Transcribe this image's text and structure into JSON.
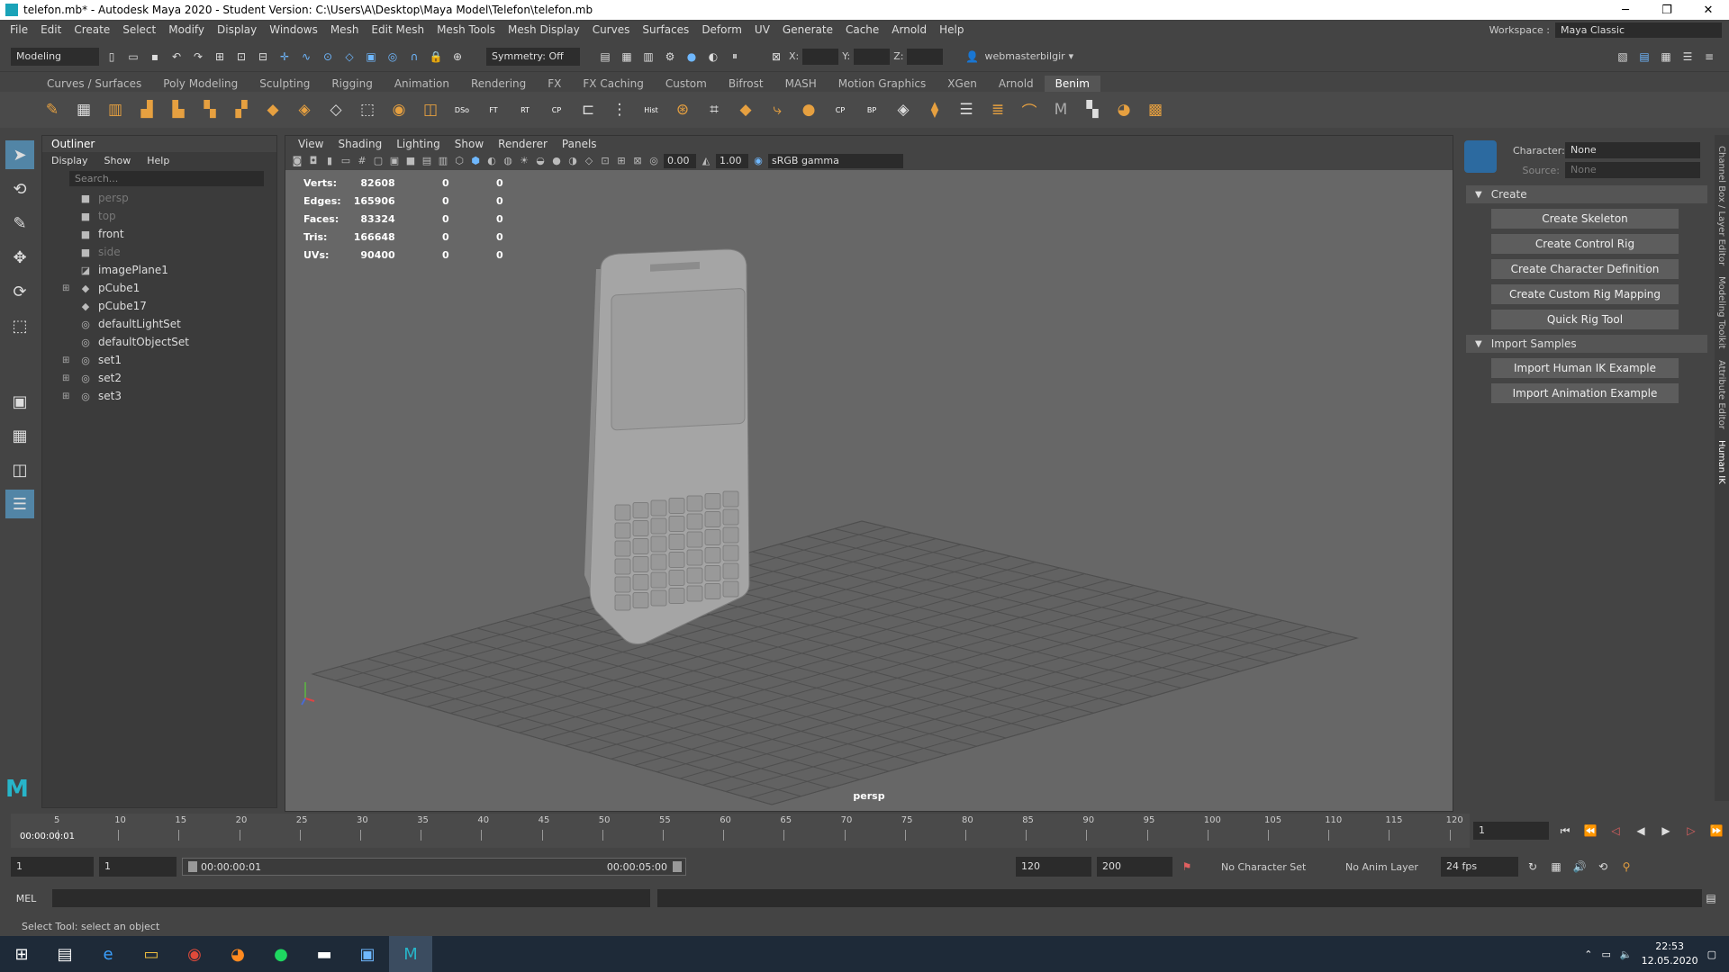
{
  "window": {
    "title": "telefon.mb* - Autodesk Maya 2020 - Student Version: C:\\Users\\A\\Desktop\\Maya Model\\Telefon\\telefon.mb"
  },
  "menubar": {
    "items": [
      "File",
      "Edit",
      "Create",
      "Select",
      "Modify",
      "Display",
      "Windows",
      "Mesh",
      "Edit Mesh",
      "Mesh Tools",
      "Mesh Display",
      "Curves",
      "Surfaces",
      "Deform",
      "UV",
      "Generate",
      "Cache",
      "Arnold",
      "Help"
    ],
    "workspace_label": "Workspace :",
    "workspace_value": "Maya Classic"
  },
  "statusline": {
    "mode": "Modeling",
    "symmetry": "Symmetry: Off",
    "x_label": "X:",
    "y_label": "Y:",
    "z_label": "Z:",
    "user": "webmasterbilgir"
  },
  "shelf": {
    "tabs": [
      "Curves / Surfaces",
      "Poly Modeling",
      "Sculpting",
      "Rigging",
      "Animation",
      "Rendering",
      "FX",
      "FX Caching",
      "Custom",
      "Bifrost",
      "MASH",
      "Motion Graphics",
      "XGen",
      "Arnold",
      "Benim"
    ],
    "active_tab": "Benim",
    "icon_labels": {
      "dso": "DSo",
      "ft": "FT",
      "rt": "RT",
      "cp": "CP",
      "hist": "Hist",
      "cp2": "CP",
      "bp": "BP"
    }
  },
  "outliner": {
    "title": "Outliner",
    "menu": [
      "Display",
      "Show",
      "Help"
    ],
    "search_placeholder": "Search...",
    "items": [
      {
        "name": "persp",
        "icon": "camera-icon",
        "dim": true,
        "expandable": false
      },
      {
        "name": "top",
        "icon": "camera-icon",
        "dim": true,
        "expandable": false
      },
      {
        "name": "front",
        "icon": "camera-icon",
        "dim": false,
        "expandable": false
      },
      {
        "name": "side",
        "icon": "camera-icon",
        "dim": true,
        "expandable": false
      },
      {
        "name": "imagePlane1",
        "icon": "imageplane-icon",
        "dim": false,
        "expandable": false
      },
      {
        "name": "pCube1",
        "icon": "mesh-icon",
        "dim": false,
        "expandable": true
      },
      {
        "name": "pCube17",
        "icon": "mesh-icon",
        "dim": false,
        "expandable": false
      },
      {
        "name": "defaultLightSet",
        "icon": "set-icon",
        "dim": false,
        "expandable": false
      },
      {
        "name": "defaultObjectSet",
        "icon": "set-icon",
        "dim": false,
        "expandable": false
      },
      {
        "name": "set1",
        "icon": "set-icon",
        "dim": false,
        "expandable": true
      },
      {
        "name": "set2",
        "icon": "set-icon",
        "dim": false,
        "expandable": true
      },
      {
        "name": "set3",
        "icon": "set-icon",
        "dim": false,
        "expandable": true
      }
    ]
  },
  "viewport": {
    "menu": [
      "View",
      "Shading",
      "Lighting",
      "Show",
      "Renderer",
      "Panels"
    ],
    "field_a": "0.00",
    "field_b": "1.00",
    "colorspace": "sRGB gamma",
    "camera_label": "persp",
    "stats": [
      {
        "label": "Verts:",
        "v1": "82608",
        "v2": "0",
        "v3": "0"
      },
      {
        "label": "Edges:",
        "v1": "165906",
        "v2": "0",
        "v3": "0"
      },
      {
        "label": "Faces:",
        "v1": "83324",
        "v2": "0",
        "v3": "0"
      },
      {
        "label": "Tris:",
        "v1": "166648",
        "v2": "0",
        "v3": "0"
      },
      {
        "label": "UVs:",
        "v1": "90400",
        "v2": "0",
        "v3": "0"
      }
    ]
  },
  "humanik": {
    "character_label": "Character:",
    "character_value": "None",
    "source_label": "Source:",
    "source_value": "None",
    "create_section": "Create",
    "create_buttons": [
      "Create Skeleton",
      "Create Control Rig",
      "Create Character Definition",
      "Create Custom Rig Mapping",
      "Quick Rig Tool"
    ],
    "import_section": "Import Samples",
    "import_buttons": [
      "Import Human IK Example",
      "Import Animation Example"
    ]
  },
  "side_tabs": [
    "Channel Box / Layer Editor",
    "Modeling Toolkit",
    "Attribute Editor",
    "Human IK"
  ],
  "timeslider": {
    "ticks": [
      "5",
      "10",
      "15",
      "20",
      "25",
      "30",
      "35",
      "40",
      "45",
      "50",
      "55",
      "60",
      "65",
      "70",
      "75",
      "80",
      "85",
      "90",
      "95",
      "100",
      "105",
      "110",
      "115",
      "120"
    ],
    "current_time": "00:00:00:01",
    "current_frame": "1"
  },
  "range": {
    "start": "1",
    "start2": "1",
    "range_start": "00:00:00:01",
    "range_end": "00:00:05:00",
    "end": "120",
    "end2": "200",
    "character_set": "No Character Set",
    "anim_layer": "No Anim Layer",
    "fps": "24 fps"
  },
  "cmdline": {
    "label": "MEL"
  },
  "helpline": {
    "text": "Select Tool: select an object"
  },
  "taskbar": {
    "time": "22:53",
    "date": "12.05.2020"
  }
}
